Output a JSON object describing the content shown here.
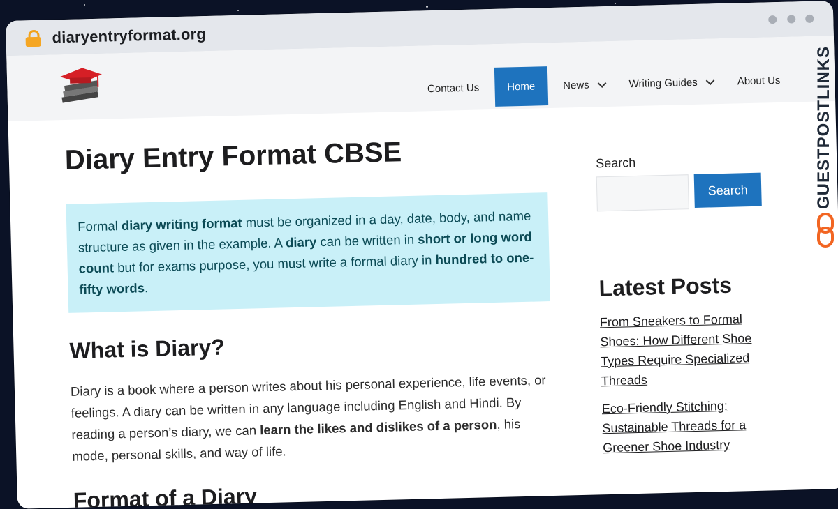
{
  "browser": {
    "url": "diaryentryformat.org"
  },
  "nav": {
    "items": [
      {
        "label": "Contact Us",
        "active": false,
        "dropdown": false
      },
      {
        "label": "Home",
        "active": true,
        "dropdown": false
      },
      {
        "label": "News",
        "active": false,
        "dropdown": true
      },
      {
        "label": "Writing Guides",
        "active": false,
        "dropdown": true
      },
      {
        "label": "About Us",
        "active": false,
        "dropdown": false
      }
    ]
  },
  "main": {
    "title": "Diary Entry Format CBSE",
    "callout_html": "Formal <b>diary writing format</b> must be organized in a day, date, body, and name structure as given in the example. A <b>diary</b> can be written in <b>short or long word count</b> but for exams purpose, you must write a formal diary in <b>hundred to one-fifty words</b>.",
    "section1_heading": "What is Diary?",
    "section1_html": "Diary is a book where a person writes about his personal experience, life events, or feelings. A diary can be written in any language including English and Hindi. By reading a person’s diary, we can <b>learn the likes and dislikes of a person</b>, his mode, personal skills, and way of life.",
    "section2_heading": "Format of a Diary"
  },
  "sidebar": {
    "search_label": "Search",
    "search_button": "Search",
    "latest_heading": "Latest Posts",
    "posts": [
      "From Sneakers to Formal Shoes: How Different Shoe Types Require Specialized Threads",
      "Eco-Friendly Stitching: Sustainable Threads for a Greener Shoe Industry"
    ]
  },
  "watermark": {
    "text": "GUESTPOSTLINKS"
  },
  "colors": {
    "accent": "#1e73be",
    "callout_bg": "#c9f0f8",
    "callout_text": "#0b4a55",
    "watermark_accent": "#f26522"
  }
}
